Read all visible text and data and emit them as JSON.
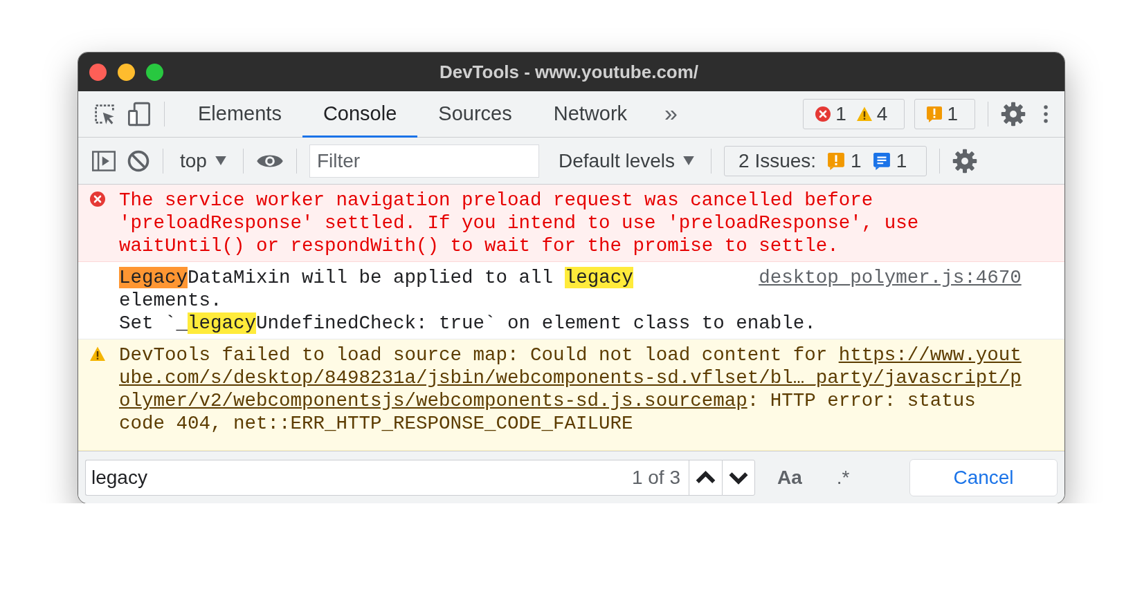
{
  "window": {
    "title": "DevTools - www.youtube.com/"
  },
  "main_toolbar": {
    "tabs": [
      {
        "label": "Elements",
        "selected": false
      },
      {
        "label": "Console",
        "selected": true
      },
      {
        "label": "Sources",
        "selected": false
      },
      {
        "label": "Network",
        "selected": false
      }
    ],
    "more_tabs": "»",
    "counters": [
      {
        "kind": "error",
        "count": "1"
      },
      {
        "kind": "warning",
        "count": "4"
      }
    ],
    "issues_badge": {
      "count": "1"
    }
  },
  "console_toolbar": {
    "context": "top",
    "filter_placeholder": "Filter",
    "levels": "Default levels",
    "issues": {
      "label": "2 Issues:",
      "counts": [
        {
          "kind": "warning",
          "count": "1"
        },
        {
          "kind": "info",
          "count": "1"
        }
      ]
    }
  },
  "messages": [
    {
      "kind": "error",
      "lines": [
        [
          {
            "kind": "text",
            "text": "The service worker navigation preload request was cancelled before"
          }
        ],
        [
          {
            "kind": "text",
            "text": "'preloadResponse' settled. If you intend to use 'preloadResponse', use"
          }
        ],
        [
          {
            "kind": "text",
            "text": "waitUntil() or respondWith() to wait for the promise to settle."
          }
        ]
      ]
    },
    {
      "kind": "info",
      "source": "desktop_polymer.js:4670",
      "lines": [
        [
          {
            "kind": "current_match",
            "text": "Legacy"
          },
          {
            "kind": "text",
            "text": "DataMixin will be applied to all "
          },
          {
            "kind": "match",
            "text": "legacy"
          }
        ],
        [
          {
            "kind": "text",
            "text": "elements."
          }
        ],
        [
          {
            "kind": "text",
            "text": "Set `_"
          },
          {
            "kind": "match",
            "text": "legacy"
          },
          {
            "kind": "text",
            "text": "UndefinedCheck: true` on element class to enable."
          }
        ]
      ]
    },
    {
      "kind": "warning",
      "lines": [
        [
          {
            "kind": "text",
            "text": "DevTools failed to load source map: Could not load content for "
          },
          {
            "kind": "link",
            "text": "https://www.yout"
          }
        ],
        [
          {
            "kind": "link",
            "text": "ube.com/s/desktop/8498231a/jsbin/webcomponents-sd.vflset/bl…_party/javascript/p"
          }
        ],
        [
          {
            "kind": "link",
            "text": "olymer/v2/webcomponentsjs/webcomponents-sd.js.sourcemap"
          },
          {
            "kind": "text",
            "text": ": HTTP error: status"
          }
        ],
        [
          {
            "kind": "text",
            "text": "code 404, net::ERR_HTTP_RESPONSE_CODE_FAILURE"
          }
        ]
      ]
    }
  ],
  "search": {
    "value": "legacy",
    "match_count": "1 of 3",
    "case_label": "Aa",
    "regex_label": ".*",
    "cancel": "Cancel"
  }
}
